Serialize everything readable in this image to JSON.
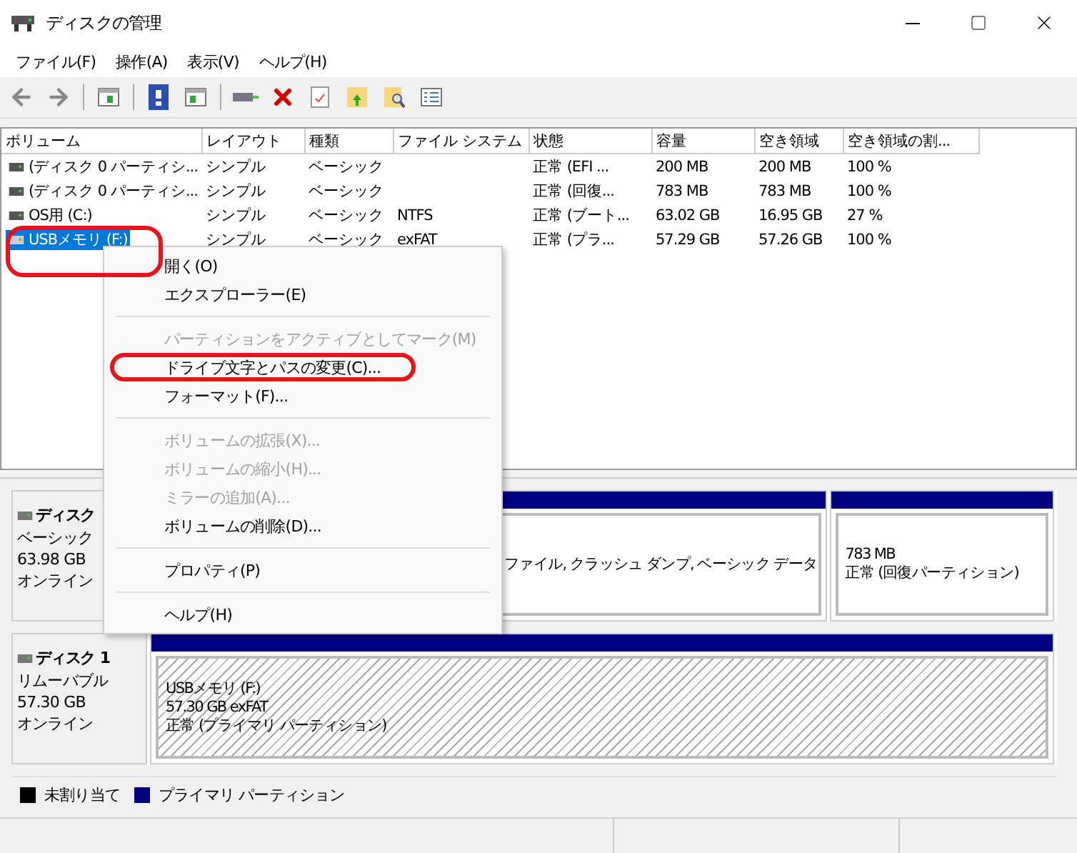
{
  "window": {
    "title": "ディスクの管理"
  },
  "menu": [
    "ファイル(F)",
    "操作(A)",
    "表示(V)",
    "ヘルプ(H)"
  ],
  "volumes": {
    "columns": [
      "ボリューム",
      "レイアウト",
      "種類",
      "ファイル システム",
      "状態",
      "容量",
      "空き領域",
      "空き領域の割..."
    ],
    "rows": [
      {
        "cells": [
          "(ディスク 0 パーティシ...",
          "シンプル",
          "ベーシック",
          "",
          "正常 (EFI ...",
          "200 MB",
          "200 MB",
          "100 %"
        ],
        "selected": false
      },
      {
        "cells": [
          "(ディスク 0 パーティシ...",
          "シンプル",
          "ベーシック",
          "",
          "正常 (回復...",
          "783 MB",
          "783 MB",
          "100 %"
        ],
        "selected": false
      },
      {
        "cells": [
          "OS用 (C:)",
          "シンプル",
          "ベーシック",
          "NTFS",
          "正常 (ブート...",
          "63.02 GB",
          "16.95 GB",
          "27 %"
        ],
        "selected": false
      },
      {
        "cells": [
          "USBメモリ (F:)",
          "シンプル",
          "ベーシック",
          "exFAT",
          "正常 (プラ...",
          "57.29 GB",
          "57.26 GB",
          "100 %"
        ],
        "selected": true
      }
    ]
  },
  "context_menu": [
    {
      "kind": "item",
      "label": "開く(O)",
      "disabled": false
    },
    {
      "kind": "item",
      "label": "エクスプローラー(E)",
      "disabled": false
    },
    {
      "kind": "separator"
    },
    {
      "kind": "item",
      "label": "パーティションをアクティブとしてマーク(M)",
      "disabled": true
    },
    {
      "kind": "item",
      "label": "ドライブ文字とパスの変更(C)...",
      "disabled": false,
      "highlighted": true
    },
    {
      "kind": "item",
      "label": "フォーマット(F)...",
      "disabled": false
    },
    {
      "kind": "separator"
    },
    {
      "kind": "item",
      "label": "ボリュームの拡張(X)...",
      "disabled": true
    },
    {
      "kind": "item",
      "label": "ボリュームの縮小(H)...",
      "disabled": true
    },
    {
      "kind": "item",
      "label": "ミラーの追加(A)...",
      "disabled": true
    },
    {
      "kind": "item",
      "label": "ボリュームの削除(D)...",
      "disabled": false
    },
    {
      "kind": "separator"
    },
    {
      "kind": "item",
      "label": "プロパティ(P)",
      "disabled": false
    },
    {
      "kind": "separator"
    },
    {
      "kind": "item",
      "label": "ヘルプ(H)",
      "disabled": false
    }
  ],
  "disks": [
    {
      "name": "ディスク",
      "type": "ベーシック",
      "size": "63.98 GB",
      "status": "オンライン",
      "partitions": [
        {
          "kind": "continued",
          "selected": false,
          "lines": [
            "ファイル, クラッシュ ダンプ, ベーシック データ"
          ]
        },
        {
          "kind": "full",
          "selected": false,
          "lines": [
            "783 MB",
            "正常 (回復パーティション)"
          ]
        }
      ]
    },
    {
      "name": "ディスク 1",
      "type": "リムーバブル",
      "size": "57.30 GB",
      "status": "オンライン",
      "partitions": [
        {
          "kind": "full",
          "selected": true,
          "lines": [
            "USBメモリ (F:)",
            "57.30 GB exFAT",
            "正常 (プライマリ パーティション)"
          ]
        }
      ]
    }
  ],
  "legend": [
    {
      "label": "未割り当て",
      "color": "#000000"
    },
    {
      "label": "プライマリ パーティション",
      "color": "#000080"
    }
  ]
}
